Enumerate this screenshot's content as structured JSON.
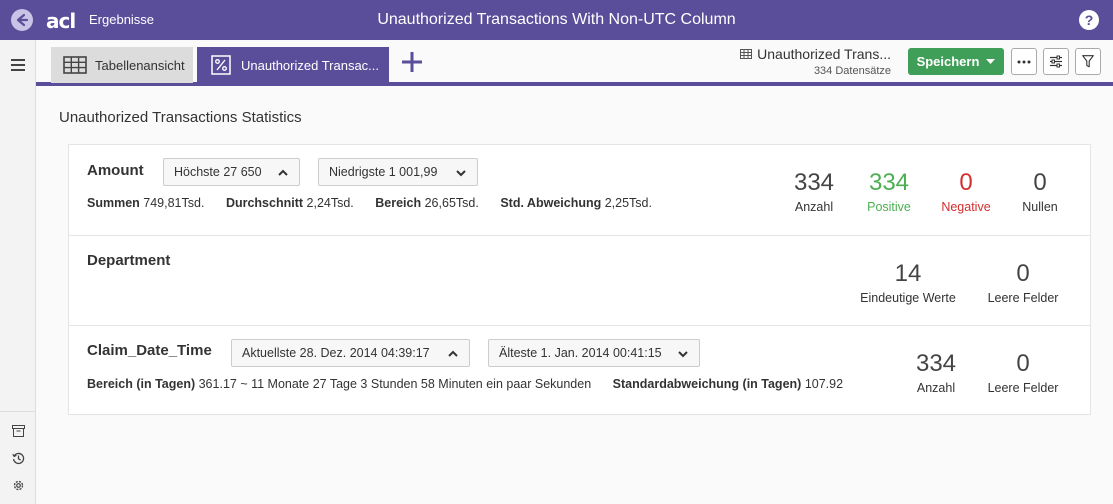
{
  "header": {
    "breadcrumb": "Ergebnisse",
    "title": "Unauthorized Transactions With Non-UTC Column",
    "logo_text": "acl",
    "help_label": "?"
  },
  "tabs": [
    {
      "label": "Tabellenansicht",
      "icon": "table-icon"
    },
    {
      "label": "Unauthorized Transac...",
      "icon": "percent-icon"
    }
  ],
  "dataset": {
    "name": "Unauthorized Trans...",
    "count": "334 Datensätze"
  },
  "toolbar": {
    "save_label": "Speichern"
  },
  "colors": {
    "brand": "#5a4d9a",
    "save": "#3f9e57",
    "positive": "#4caf50",
    "negative": "#d32f2f"
  },
  "content": {
    "heading": "Unauthorized Transactions Statistics",
    "fields": [
      {
        "name": "Amount",
        "dropdown_high": "Höchste 27 650",
        "dropdown_low": "Niedrigste 1 001,99",
        "stats": [
          {
            "label": "Summen",
            "value": "749,81Tsd."
          },
          {
            "label": "Durchschnitt",
            "value": "2,24Tsd."
          },
          {
            "label": "Bereich",
            "value": "26,65Tsd."
          },
          {
            "label": "Std. Abweichung",
            "value": "2,25Tsd."
          }
        ],
        "metrics": [
          {
            "value": "334",
            "label": "Anzahl"
          },
          {
            "value": "334",
            "label": "Positive"
          },
          {
            "value": "0",
            "label": "Negative"
          },
          {
            "value": "0",
            "label": "Nullen"
          }
        ]
      },
      {
        "name": "Department",
        "metrics": [
          {
            "value": "14",
            "label": "Eindeutige Werte"
          },
          {
            "value": "0",
            "label": "Leere Felder"
          }
        ]
      },
      {
        "name": "Claim_Date_Time",
        "dropdown_high": "Aktuellste 28. Dez. 2014 04:39:17",
        "dropdown_low": "Älteste 1. Jan. 2014 00:41:15",
        "stats": [
          {
            "label": "Bereich (in Tagen)",
            "value": "361.17 ~ 11 Monate 27 Tage 3 Stunden 58 Minuten ein paar Sekunden"
          },
          {
            "label": "Standardabweichung (in Tagen)",
            "value": "107.92"
          }
        ],
        "metrics": [
          {
            "value": "334",
            "label": "Anzahl"
          },
          {
            "value": "0",
            "label": "Leere Felder"
          }
        ]
      }
    ]
  }
}
